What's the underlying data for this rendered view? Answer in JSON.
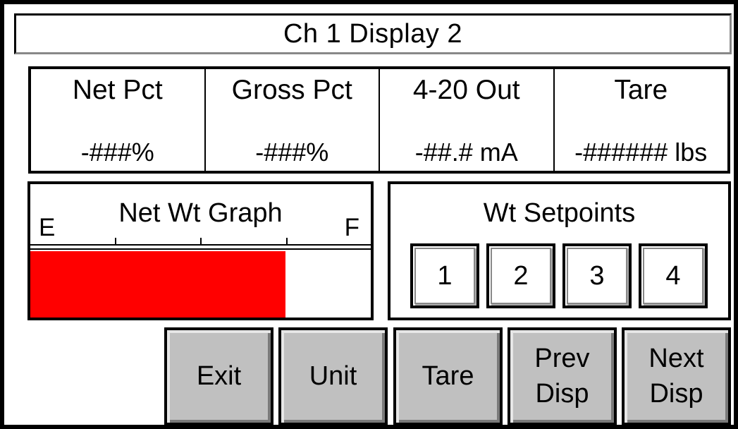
{
  "window": {
    "title": "Ch 1 Display 2"
  },
  "readouts": [
    {
      "label": "Net Pct",
      "value": "-###%"
    },
    {
      "label": "Gross Pct",
      "value": "-###%"
    },
    {
      "label": "4-20 Out",
      "value": "-##.# mA"
    },
    {
      "label": "Tare",
      "value": "-###### lbs"
    }
  ],
  "graph": {
    "title": "Net Wt Graph",
    "empty_label": "E",
    "full_label": "F",
    "fill_fraction": 0.75,
    "fill_color": "#ff0000"
  },
  "setpoints": {
    "title": "Wt Setpoints",
    "buttons": [
      "1",
      "2",
      "3",
      "4"
    ]
  },
  "buttons": {
    "exit": "Exit",
    "unit": "Unit",
    "tare": "Tare",
    "prev": "Prev\nDisp",
    "next": "Next\nDisp"
  }
}
